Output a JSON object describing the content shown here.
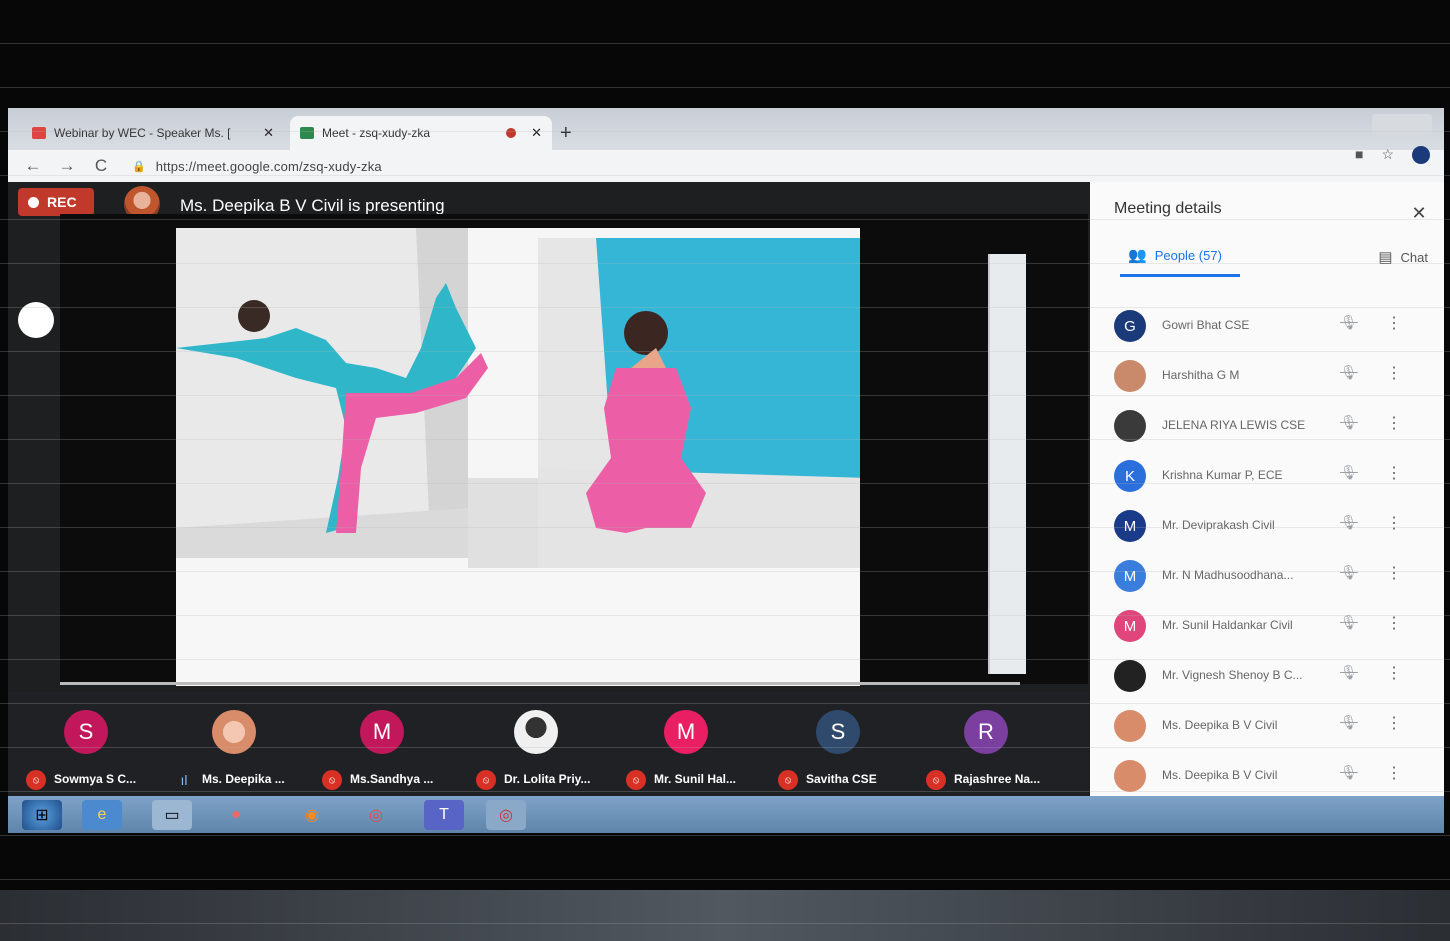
{
  "browser": {
    "tabs": [
      {
        "label": "Webinar by WEC - Speaker Ms. [",
        "close": "✕"
      },
      {
        "label": "Meet - zsq-xudy-zka",
        "close": "✕"
      }
    ],
    "new_tab": "+",
    "url": "https://meet.google.com/zsq-xudy-zka",
    "nav": {
      "back": "←",
      "forward": "→",
      "reload": "C"
    }
  },
  "meet": {
    "rec_label": "REC",
    "presenting_text": "Ms. Deepika B V Civil is presenting",
    "participants_strip": [
      {
        "initial": "S",
        "name": "Sowmya S C...",
        "color": "#c2185b",
        "mic": "muted"
      },
      {
        "initial": "",
        "name": "Ms. Deepika ...",
        "color": "#d98c6a",
        "mic": "speaking"
      },
      {
        "initial": "M",
        "name": "Ms.Sandhya ...",
        "color": "#c2185b",
        "mic": "muted"
      },
      {
        "initial": "",
        "name": "Dr. Lolita Priy...",
        "color": "#e8e8e8",
        "mic": "muted"
      },
      {
        "initial": "M",
        "name": "Mr. Sunil Hal...",
        "color": "#e91e63",
        "mic": "muted"
      },
      {
        "initial": "S",
        "name": "Savitha CSE",
        "color": "#2f4a6d",
        "mic": "muted"
      },
      {
        "initial": "R",
        "name": "Rajashree Na...",
        "color": "#7b3fa0",
        "mic": "muted"
      }
    ]
  },
  "panel": {
    "title": "Meeting details",
    "close": "✕",
    "people_tab": "People (57)",
    "chat_tab": "Chat",
    "people": [
      {
        "initial": "G",
        "name": "Gowri Bhat CSE",
        "color": "#1a3a7a"
      },
      {
        "initial": "",
        "name": "Harshitha G M",
        "color": "#c98a6c"
      },
      {
        "initial": "",
        "name": "JELENA RIYA LEWIS CSE",
        "color": "#3a3a3a"
      },
      {
        "initial": "K",
        "name": "Krishna Kumar P, ECE",
        "color": "#2a6fdb"
      },
      {
        "initial": "M",
        "name": "Mr. Deviprakash Civil",
        "color": "#1a3a8a"
      },
      {
        "initial": "M",
        "name": "Mr. N Madhusoodhana...",
        "color": "#3b7ddd"
      },
      {
        "initial": "M",
        "name": "Mr. Sunil Haldankar Civil",
        "color": "#e0457b"
      },
      {
        "initial": "",
        "name": "Mr. Vignesh Shenoy B C...",
        "color": "#222"
      },
      {
        "initial": "",
        "name": "Ms. Deepika B V Civil",
        "color": "#d98c6a"
      },
      {
        "initial": "",
        "name": "Ms. Deepika B V Civil",
        "color": "#d98c6a"
      }
    ]
  },
  "taskbar": {
    "items": [
      "start",
      "ie",
      "folder",
      "media",
      "firefox",
      "chrome",
      "teams",
      "chrome2"
    ]
  }
}
